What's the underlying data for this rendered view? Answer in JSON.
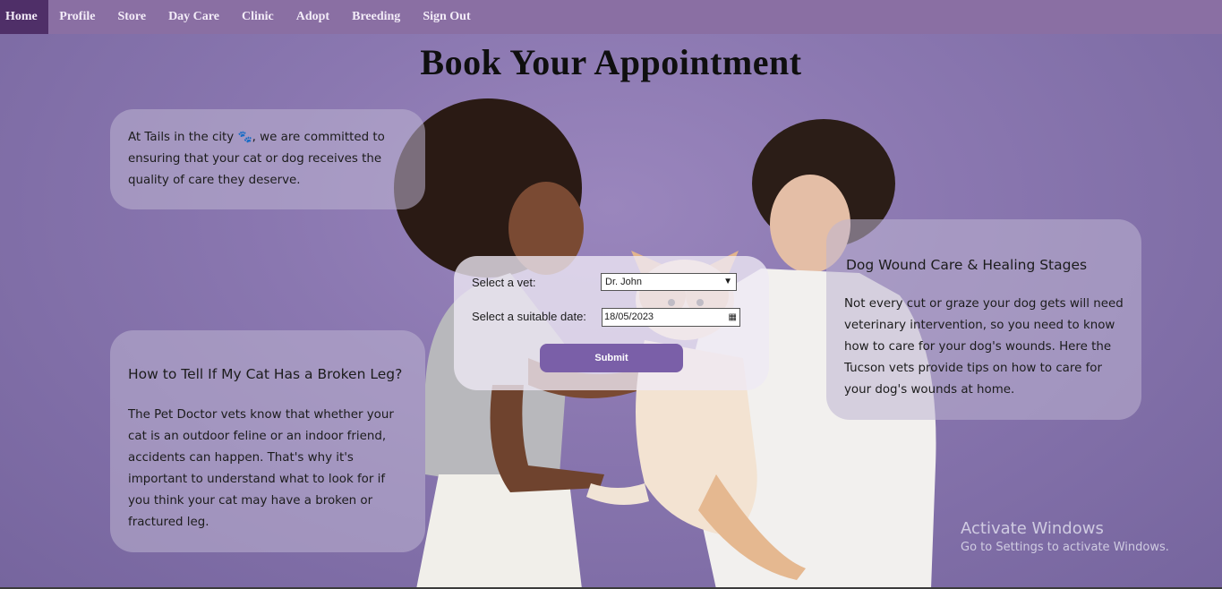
{
  "nav": {
    "items": [
      {
        "label": "Home",
        "active": true
      },
      {
        "label": "Profile"
      },
      {
        "label": "Store"
      },
      {
        "label": "Day Care"
      },
      {
        "label": "Clinic"
      },
      {
        "label": "Adopt"
      },
      {
        "label": "Breeding"
      },
      {
        "label": "Sign Out"
      }
    ]
  },
  "page": {
    "title": "Book Your Appointment"
  },
  "commitment_card": {
    "text_before": "At Tails in the city ",
    "icon": "paw-print-icon",
    "text_after": ", we are committed to ensuring that your cat or dog receives the quality of care they deserve."
  },
  "cat_card": {
    "heading": "How to Tell If My Cat Has a Broken Leg?",
    "body": "The Pet Doctor vets know that whether your cat is an outdoor feline or an indoor friend, accidents can happen. That's why it's important to understand what to look for if you think your cat may have a broken or fractured leg."
  },
  "dog_card": {
    "heading": "Dog Wound Care & Healing Stages",
    "body": "Not every cut or graze your dog gets will need veterinary intervention, so you need to know how to care for your dog's wounds. Here the Tucson vets provide tips on how to care for your dog's wounds at home."
  },
  "booking_form": {
    "vet_label": "Select a vet:",
    "vet_value": "Dr. John",
    "date_label": "Select a suitable date:",
    "date_value": "18/05/2023",
    "submit_label": "Submit"
  },
  "watermark": {
    "title": "Activate Windows",
    "subtitle": "Go to Settings to activate Windows."
  },
  "colors": {
    "nav_bg": "#8a6fa3",
    "nav_active": "#4f2f68",
    "page_bg": "#8a77b0",
    "submit_bg": "#7a5fa8"
  }
}
